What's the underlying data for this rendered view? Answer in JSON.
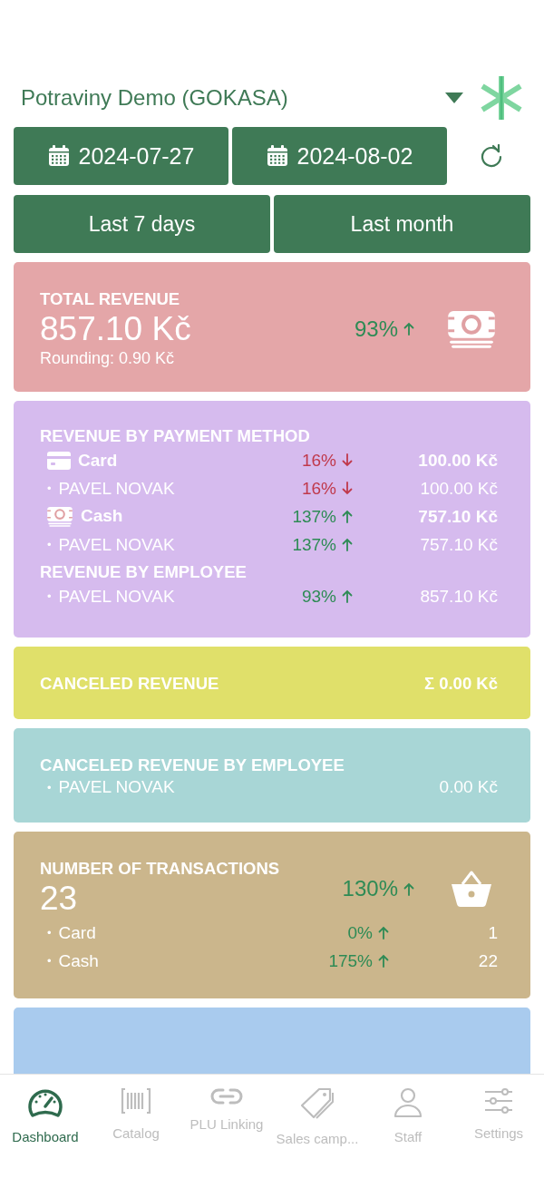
{
  "header": {
    "store": "Potraviny Demo (GOKASA)"
  },
  "dates": [
    {
      "label": "2024-07-27"
    },
    {
      "label": "2024-08-02"
    }
  ],
  "presets": [
    {
      "label": "Last 7 days"
    },
    {
      "label": "Last month"
    }
  ],
  "cards": [
    {
      "kind": "total",
      "color": "#e4a6a8",
      "title": "TOTAL REVENUE",
      "value": "857.10 Kč",
      "note": "Rounding: 0.90 Kč",
      "trend": {
        "text": "93%",
        "rising": true
      }
    },
    {
      "kind": "sections",
      "color": "#d6bbee",
      "sections": [
        {
          "title": "REVENUE BY PAYMENT METHOD",
          "rows": [
            {
              "kind": "card",
              "label": "Card",
              "trend": {
                "text": "16%",
                "rising": false
              },
              "amount": "100.00 Kč"
            },
            {
              "kind": "person",
              "bullet": "•",
              "label": "PAVEL NOVAK",
              "trend": {
                "text": "16%",
                "rising": false
              },
              "amount": "100.00 Kč"
            },
            {
              "kind": "cash",
              "label": "Cash",
              "trend": {
                "text": "137%",
                "rising": true
              },
              "amount": "757.10 Kč"
            },
            {
              "kind": "person",
              "bullet": "•",
              "label": "PAVEL NOVAK",
              "trend": {
                "text": "137%",
                "rising": true
              },
              "amount": "757.10 Kč"
            }
          ]
        },
        {
          "title": "REVENUE BY EMPLOYEE",
          "rows": [
            {
              "kind": "person",
              "bullet": "•",
              "label": "PAVEL NOVAK",
              "trend": {
                "text": "93%",
                "rising": true
              },
              "amount": "857.10 Kč"
            }
          ]
        }
      ]
    },
    {
      "kind": "sum",
      "color": "#e0e06a",
      "title": "CANCELED REVENUE",
      "value": "Σ 0.00 Kč"
    },
    {
      "kind": "list",
      "color": "#a8d6d6",
      "title": "CANCELED REVENUE BY EMPLOYEE",
      "rows": [
        {
          "bullet": "•",
          "label": "PAVEL NOVAK",
          "amount": "0.00 Kč"
        }
      ]
    },
    {
      "kind": "count",
      "color": "#cbb68c",
      "title": "NUMBER OF TRANSACTIONS",
      "value": "23",
      "trend": {
        "text": "130%",
        "rising": true
      },
      "rows": [
        {
          "bullet": "•",
          "label": "Card",
          "trend": {
            "text": "0%",
            "rising": true
          },
          "amount": "1"
        },
        {
          "bullet": "•",
          "label": "Cash",
          "trend": {
            "text": "175%",
            "rising": true
          },
          "amount": "22"
        }
      ]
    },
    {
      "kind": "cut",
      "color": "#a9cbee"
    }
  ],
  "tabs": [
    {
      "label": "Dashboard",
      "selected": true
    },
    {
      "label": "Catalog",
      "selected": false
    },
    {
      "label": "PLU Linking",
      "selected": false
    },
    {
      "label": "Sales camp...",
      "selected": false
    },
    {
      "label": "Staff",
      "selected": false
    },
    {
      "label": "Settings",
      "selected": false
    }
  ]
}
